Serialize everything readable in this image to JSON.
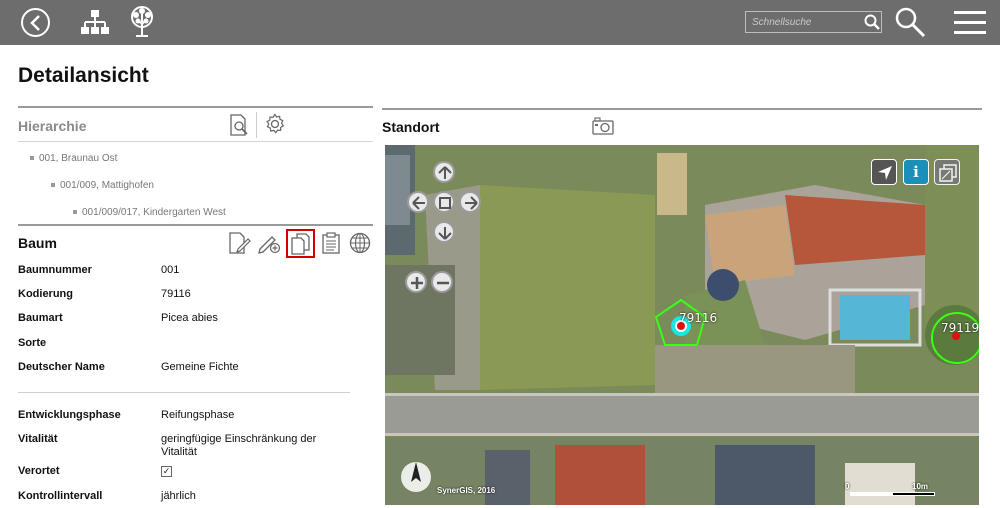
{
  "header": {
    "search_placeholder": "Schnellsuche"
  },
  "page": {
    "title": "Detailansicht"
  },
  "hierarchy": {
    "title": "Hierarchie",
    "items": [
      {
        "label": "001, Braunau Ost"
      },
      {
        "label": "001/009, Mattighofen"
      },
      {
        "label": "001/009/017, Kindergarten West"
      }
    ]
  },
  "baum": {
    "title": "Baum",
    "attributes": [
      {
        "label": "Baumnummer",
        "value": "001"
      },
      {
        "label": "Kodierung",
        "value": "79116"
      },
      {
        "label": "Baumart",
        "value": "Picea abies"
      },
      {
        "label": "Sorte",
        "value": ""
      },
      {
        "label": "Deutscher Name",
        "value": "Gemeine Fichte"
      },
      {
        "label": "Entwicklungsphase",
        "value": "Reifungsphase"
      },
      {
        "label": "Vitalität",
        "value": "geringfügige Einschränkung der Vitalität"
      },
      {
        "label": "Verortet",
        "value": "✓"
      },
      {
        "label": "Kontrollintervall",
        "value": "jährlich"
      }
    ]
  },
  "standort": {
    "title": "Standort",
    "map": {
      "markers": [
        {
          "label": "79116",
          "color": "#39ff14"
        },
        {
          "label": "79119",
          "color": "#39ff14"
        }
      ],
      "copyright": "SynerGIS, 2016",
      "scale_start": "0",
      "scale_end": "10m",
      "info_button_label": "i"
    }
  },
  "colors": {
    "topbar": "#6d6d6d",
    "highlight": "#d40000",
    "info_button": "#1a8fb8"
  }
}
